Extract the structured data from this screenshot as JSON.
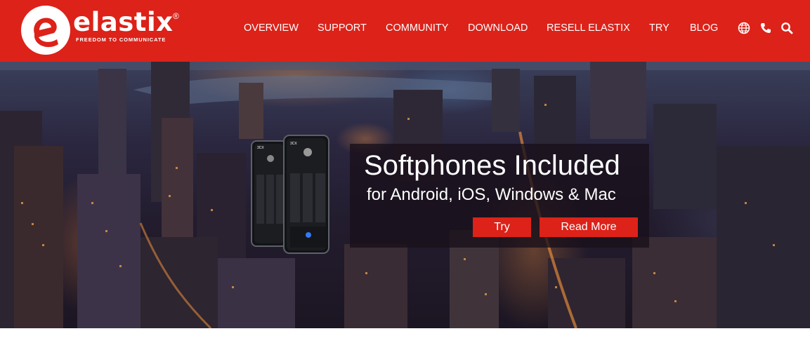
{
  "brand": {
    "name": "elastix",
    "registered": "®",
    "tagline": "FREEDOM TO COMMUNICATE",
    "color": "#dc2219"
  },
  "nav": {
    "items": [
      {
        "label": "OVERVIEW"
      },
      {
        "label": "SUPPORT"
      },
      {
        "label": "COMMUNITY"
      },
      {
        "label": "DOWNLOAD"
      },
      {
        "label": "RESELL ELASTIX"
      },
      {
        "label": "TRY"
      },
      {
        "label": "BLOG"
      }
    ],
    "icons": [
      "globe-icon",
      "phone-icon",
      "search-icon"
    ]
  },
  "hero": {
    "title": "Softphones Included",
    "subtitle": "for Android, iOS, Windows & Mac",
    "try_label": "Try",
    "read_more_label": "Read More"
  },
  "phone_app": {
    "brand": "3CX"
  }
}
